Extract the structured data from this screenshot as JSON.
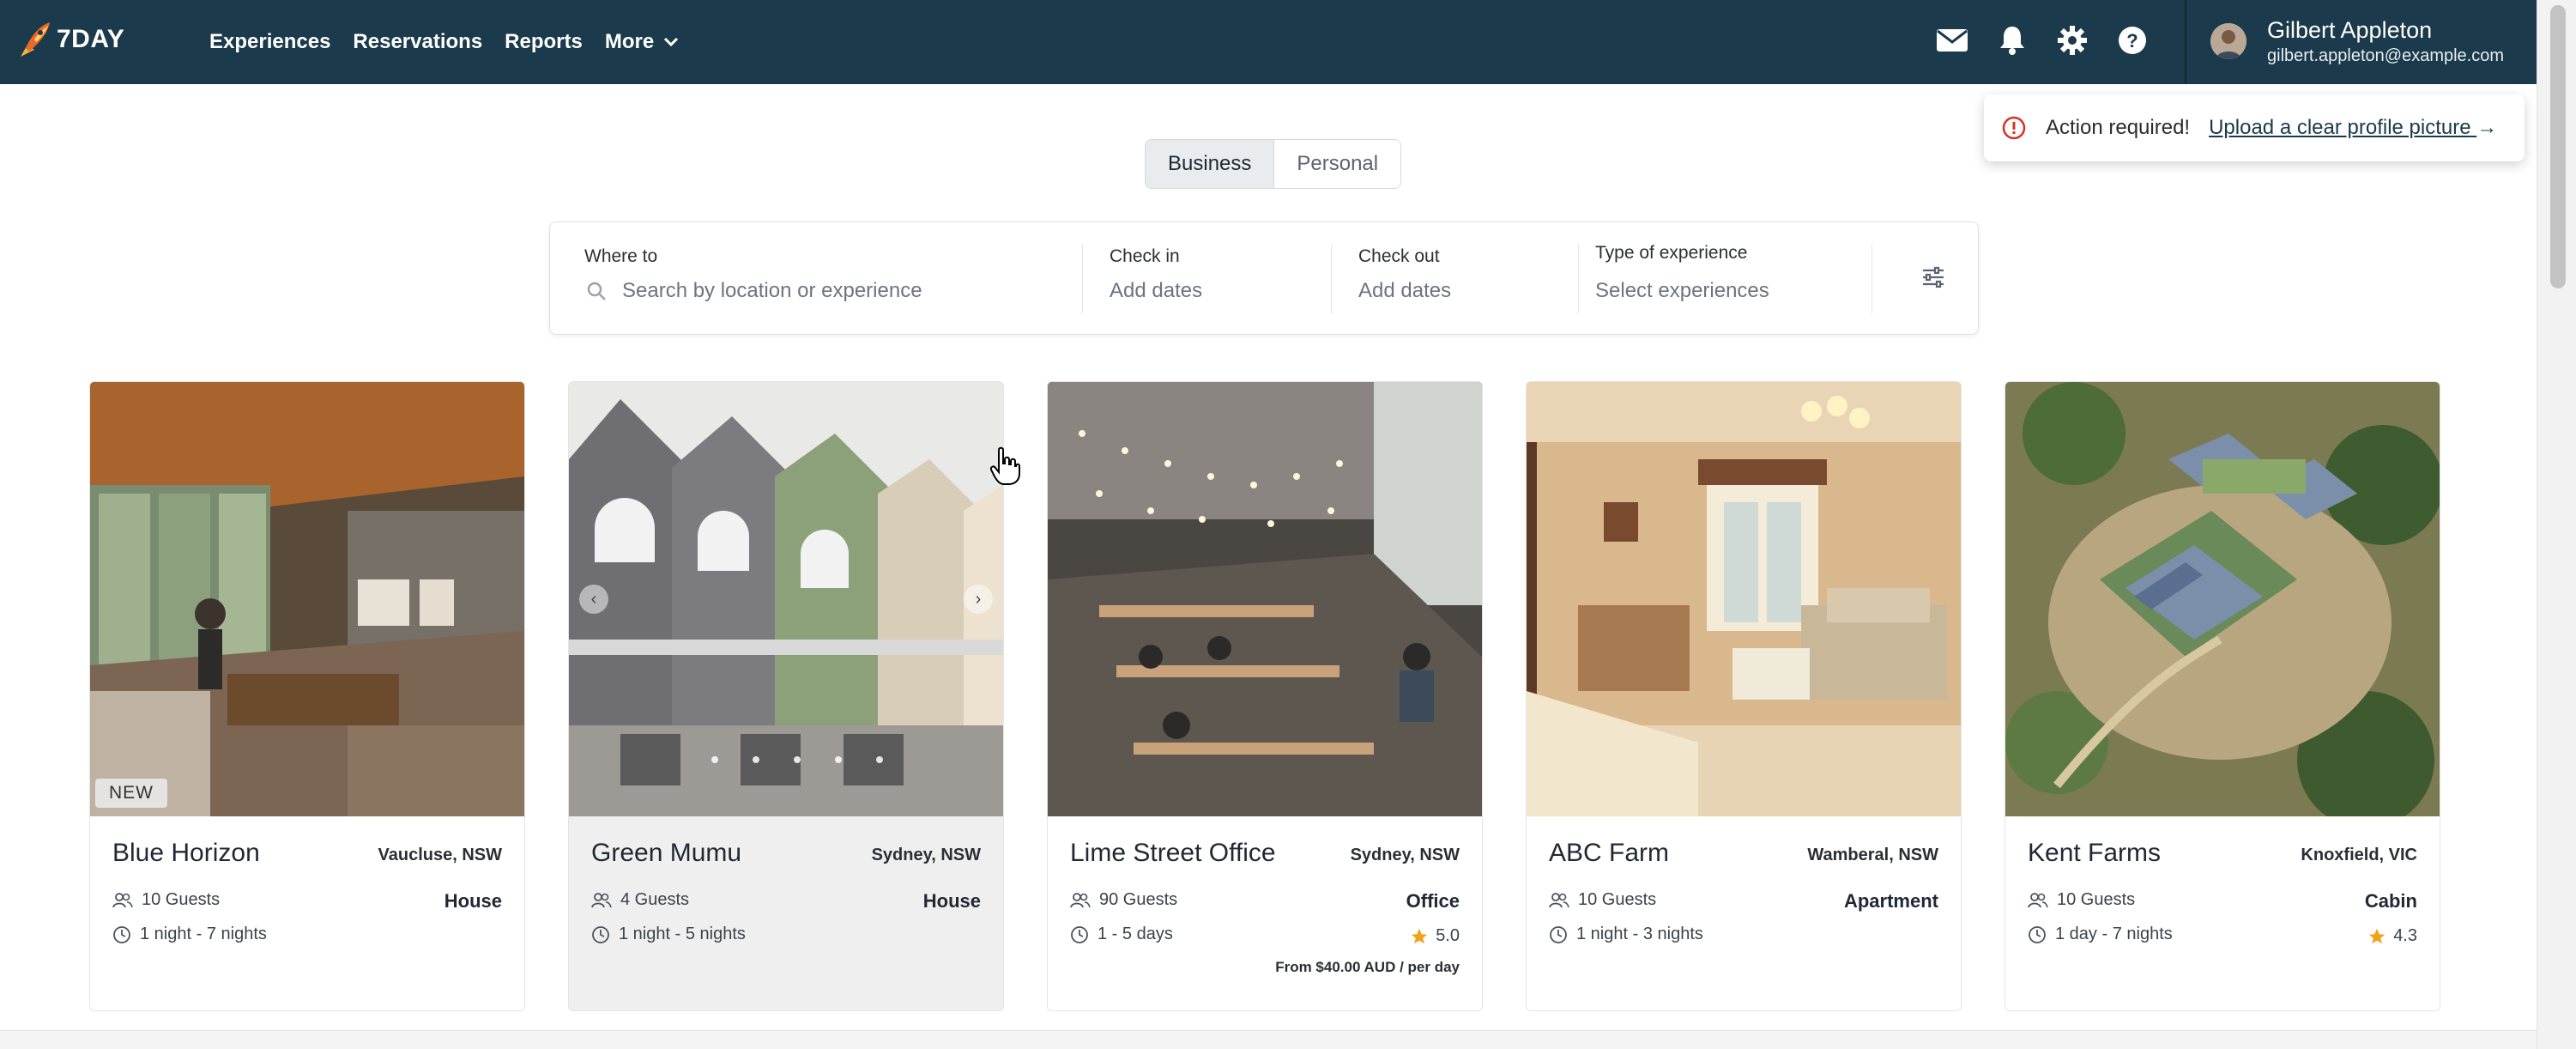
{
  "brand": {
    "name": "7DAY"
  },
  "nav": {
    "experiences": "Experiences",
    "reservations": "Reservations",
    "reports": "Reports",
    "more": "More"
  },
  "header_icons": [
    "mail-icon",
    "bell-icon",
    "gear-icon",
    "help-icon"
  ],
  "user": {
    "name": "Gilbert Appleton",
    "email": "gilbert.appleton@example.com"
  },
  "toast": {
    "message": "Action required!",
    "link": "Upload a clear profile picture",
    "arrow": "→"
  },
  "mode_toggle": {
    "business": "Business",
    "personal": "Personal",
    "selected": "Business"
  },
  "search": {
    "where_label": "Where to",
    "where_placeholder": "Search by location or experience",
    "checkin_label": "Check in",
    "checkin_value": "Add dates",
    "checkout_label": "Check out",
    "checkout_value": "Add dates",
    "type_label": "Type of experience",
    "type_value": "Select experiences"
  },
  "colors": {
    "header_bg": "#1b3a4b",
    "star": "#f2a21a",
    "error": "#d93025"
  },
  "listings": [
    {
      "title": "Blue Horizon",
      "location": "Vaucluse, NSW",
      "guests": "10 Guests",
      "duration": "1 night - 7 nights",
      "type": "House",
      "badge": "NEW"
    },
    {
      "title": "Green Mumu",
      "location": "Sydney, NSW",
      "guests": "4 Guests",
      "duration": "1 night - 5 nights",
      "type": "House"
    },
    {
      "title": "Lime Street Office",
      "location": "Sydney, NSW",
      "guests": "90 Guests",
      "duration": "1 - 5 days",
      "type": "Office",
      "rating": "5.0",
      "price": "From $40.00 AUD / per day"
    },
    {
      "title": "ABC Farm",
      "location": "Wamberal, NSW",
      "guests": "10 Guests",
      "duration": "1 night - 3 nights",
      "type": "Apartment"
    },
    {
      "title": "Kent Farms",
      "location": "Knoxfield, VIC",
      "guests": "10 Guests",
      "duration": "1 day - 7 nights",
      "rating": "4.3",
      "type": "Cabin"
    }
  ]
}
